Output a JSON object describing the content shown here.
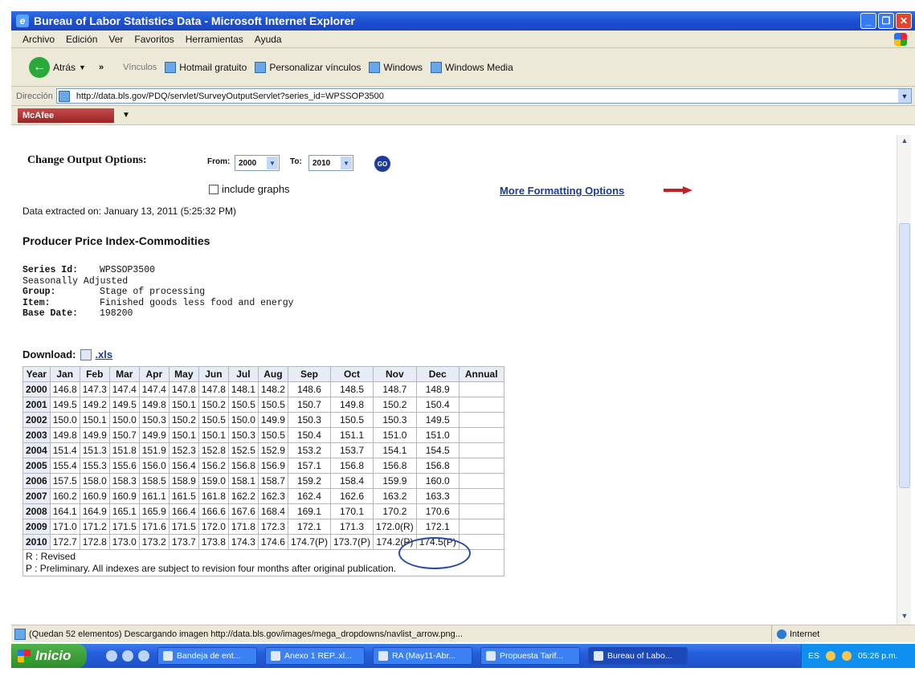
{
  "window": {
    "title": "Bureau of Labor Statistics Data - Microsoft Internet Explorer"
  },
  "menu": [
    "Archivo",
    "Edición",
    "Ver",
    "Favoritos",
    "Herramientas",
    "Ayuda"
  ],
  "links_bar": {
    "back_label": "Atrás",
    "links_label": "Vínculos",
    "links": [
      "Hotmail gratuito",
      "Personalizar vínculos",
      "Windows",
      "Windows Media"
    ]
  },
  "address": {
    "label": "Dirección",
    "url": "http://data.bls.gov/PDQ/servlet/SurveyOutputServlet?series_id=WPSSOP3500"
  },
  "mcafee": {
    "label": "McAfee"
  },
  "page": {
    "change_output_label": "Change Output Options:",
    "from_label": "From:",
    "from_value": "2000",
    "to_label": "To:",
    "to_value": "2010",
    "go_label": "GO",
    "include_graphs_label": "include graphs",
    "more_formatting_label": "More Formatting Options",
    "extracted_text": "Data extracted on: January 13, 2011 (5:25:32 PM)",
    "index_title": "Producer Price Index-Commodities",
    "series_info": [
      {
        "key": "Series Id:",
        "value": "WPSSOP3500"
      },
      {
        "key": "Seasonally Adjusted",
        "value": ""
      },
      {
        "key": "Group:",
        "value": "Stage of processing"
      },
      {
        "key": "Item:",
        "value": "Finished goods less food and energy"
      },
      {
        "key": "Base Date:",
        "value": "198200"
      }
    ],
    "download_label": "Download:",
    "download_link": ".xls",
    "table": {
      "headers": [
        "Year",
        "Jan",
        "Feb",
        "Mar",
        "Apr",
        "May",
        "Jun",
        "Jul",
        "Aug",
        "Sep",
        "Oct",
        "Nov",
        "Dec",
        "Annual"
      ],
      "rows": [
        [
          "2000",
          "146.8",
          "147.3",
          "147.4",
          "147.4",
          "147.8",
          "147.8",
          "148.1",
          "148.2",
          "148.6",
          "148.5",
          "148.7",
          "148.9",
          ""
        ],
        [
          "2001",
          "149.5",
          "149.2",
          "149.5",
          "149.8",
          "150.1",
          "150.2",
          "150.5",
          "150.5",
          "150.7",
          "149.8",
          "150.2",
          "150.4",
          ""
        ],
        [
          "2002",
          "150.0",
          "150.1",
          "150.0",
          "150.3",
          "150.2",
          "150.5",
          "150.0",
          "149.9",
          "150.3",
          "150.5",
          "150.3",
          "149.5",
          ""
        ],
        [
          "2003",
          "149.8",
          "149.9",
          "150.7",
          "149.9",
          "150.1",
          "150.1",
          "150.3",
          "150.5",
          "150.4",
          "151.1",
          "151.0",
          "151.0",
          ""
        ],
        [
          "2004",
          "151.4",
          "151.3",
          "151.8",
          "151.9",
          "152.3",
          "152.8",
          "152.5",
          "152.9",
          "153.2",
          "153.7",
          "154.1",
          "154.5",
          ""
        ],
        [
          "2005",
          "155.4",
          "155.3",
          "155.6",
          "156.0",
          "156.4",
          "156.2",
          "156.8",
          "156.9",
          "157.1",
          "156.8",
          "156.8",
          "156.8",
          ""
        ],
        [
          "2006",
          "157.5",
          "158.0",
          "158.3",
          "158.5",
          "158.9",
          "159.0",
          "158.1",
          "158.7",
          "159.2",
          "158.4",
          "159.9",
          "160.0",
          ""
        ],
        [
          "2007",
          "160.2",
          "160.9",
          "160.9",
          "161.1",
          "161.5",
          "161.8",
          "162.2",
          "162.3",
          "162.4",
          "162.6",
          "163.2",
          "163.3",
          ""
        ],
        [
          "2008",
          "164.1",
          "164.9",
          "165.1",
          "165.9",
          "166.4",
          "166.6",
          "167.6",
          "168.4",
          "169.1",
          "170.1",
          "170.2",
          "170.6",
          ""
        ],
        [
          "2009",
          "171.0",
          "171.2",
          "171.5",
          "171.6",
          "171.5",
          "172.0",
          "171.8",
          "172.3",
          "172.1",
          "171.3",
          "172.0(R)",
          "172.1",
          ""
        ],
        [
          "2010",
          "172.7",
          "172.8",
          "173.0",
          "173.2",
          "173.7",
          "173.8",
          "174.3",
          "174.6",
          "174.7(P)",
          "173.7(P)",
          "174.2(P)",
          "174.5(P)",
          ""
        ]
      ],
      "note_revised": "R : Revised",
      "note_preliminary": "P : Preliminary. All indexes are subject to revision four months after original publication."
    }
  },
  "status": {
    "text": "(Quedan 52 elementos) Descargando imagen http://data.bls.gov/images/mega_dropdowns/navlist_arrow.png...",
    "zone": "Internet"
  },
  "taskbar": {
    "start_label": "Inicio",
    "tasks": [
      "Bandeja de ent...",
      "Anexo 1 REP..xl...",
      "RA (May11-Abr...",
      "Propuesta Tarif...",
      "Bureau of Labo..."
    ],
    "lang": "ES",
    "clock": "05:26 p.m."
  },
  "colors": {
    "title_bar": "#245edb",
    "link_blue": "#1a3b9a",
    "accent_red": "#c0222a"
  }
}
